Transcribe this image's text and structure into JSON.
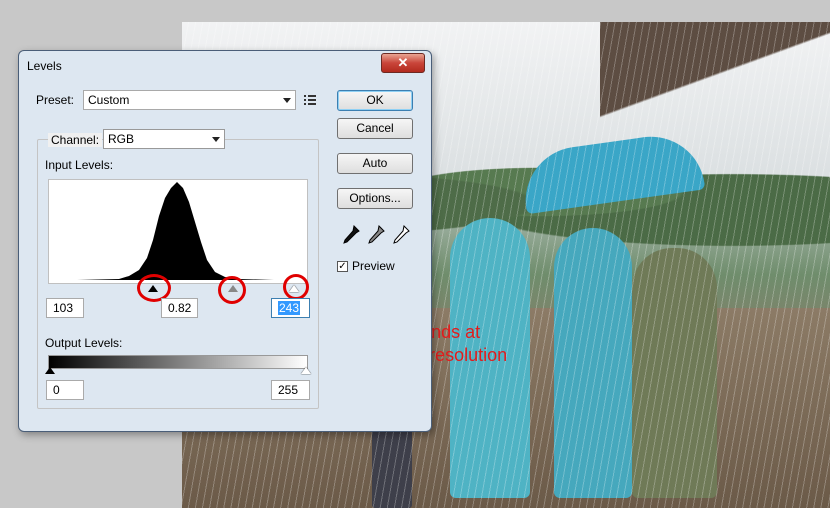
{
  "dialog": {
    "title": "Levels",
    "close_label": "✕",
    "preset_label": "Preset:",
    "preset_value": "Custom",
    "channel_label": "Channel:",
    "channel_value": "RGB",
    "input_levels_label": "Input Levels:",
    "input_black": "103",
    "input_gamma": "0.82",
    "input_white": "243",
    "output_levels_label": "Output Levels:",
    "output_black": "0",
    "output_white": "255",
    "buttons": {
      "ok": "OK",
      "cancel": "Cancel",
      "auto": "Auto",
      "options": "Options..."
    },
    "preview_label": "Preview",
    "preview_checked": true
  },
  "annotation": {
    "text": "Just drag it\nSetup depends at\nyour photo resolution",
    "color": "#e31b1b"
  },
  "icons": {
    "preset_menu": "list-menu-icon",
    "droppers": [
      "black-eyedropper-icon",
      "gray-eyedropper-icon",
      "white-eyedropper-icon"
    ],
    "close": "close-icon"
  },
  "colors": {
    "highlight_ring": "#e00000",
    "selection": "#3399ff"
  }
}
